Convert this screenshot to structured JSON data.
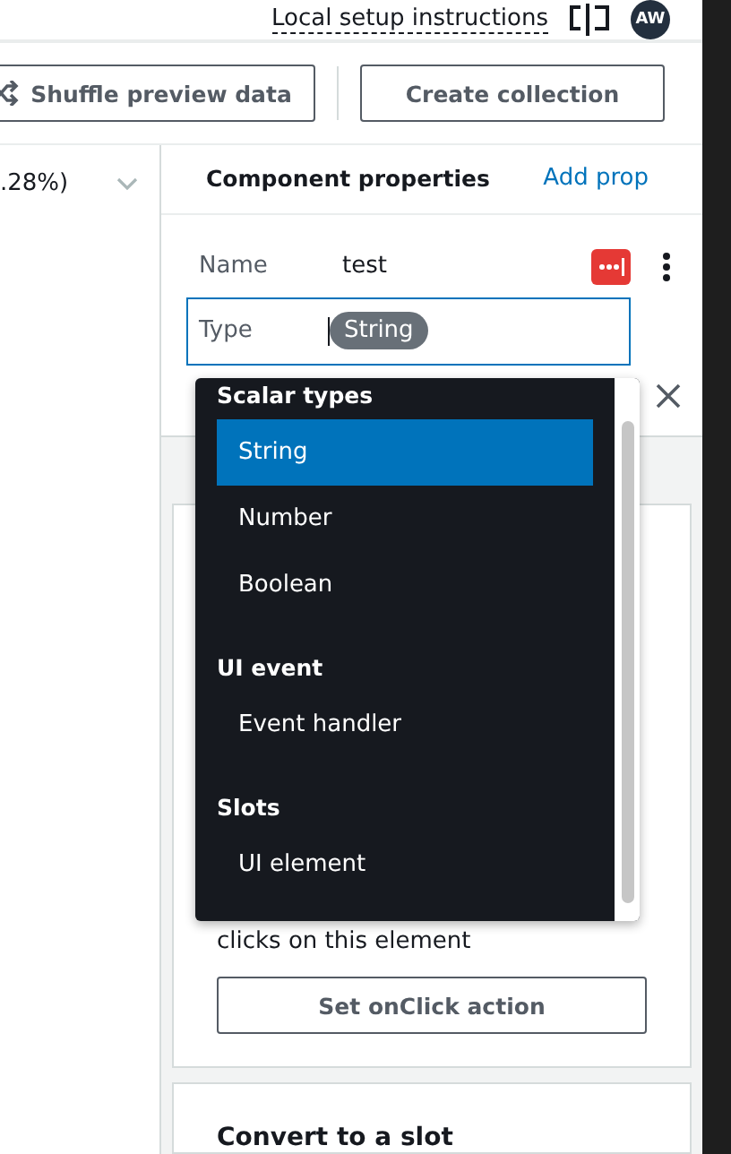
{
  "header": {
    "setup_link": "Local setup instructions",
    "avatar": "AW"
  },
  "toolbar": {
    "buttons": [
      "Shuffle preview data",
      "Create collection"
    ]
  },
  "left_column": {
    "value": ".28%)"
  },
  "properties": {
    "title": "Component properties",
    "add_link": "Add prop",
    "name_label": "Name",
    "name_value": "test",
    "type_label": "Type",
    "type_value": "String"
  },
  "dropdown": {
    "groups": [
      {
        "label": "Scalar types",
        "options": [
          {
            "label": "String",
            "selected": true
          },
          {
            "label": "Number",
            "selected": false
          },
          {
            "label": "Boolean",
            "selected": false
          }
        ]
      },
      {
        "label": "UI event",
        "options": [
          {
            "label": "Event handler",
            "selected": false
          }
        ]
      },
      {
        "label": "Slots",
        "options": [
          {
            "label": "UI element",
            "selected": false
          }
        ]
      }
    ]
  },
  "action_card": {
    "text": "clicks on this element",
    "button": "Set onClick action"
  },
  "slot_card": {
    "title": "Convert to a slot"
  }
}
